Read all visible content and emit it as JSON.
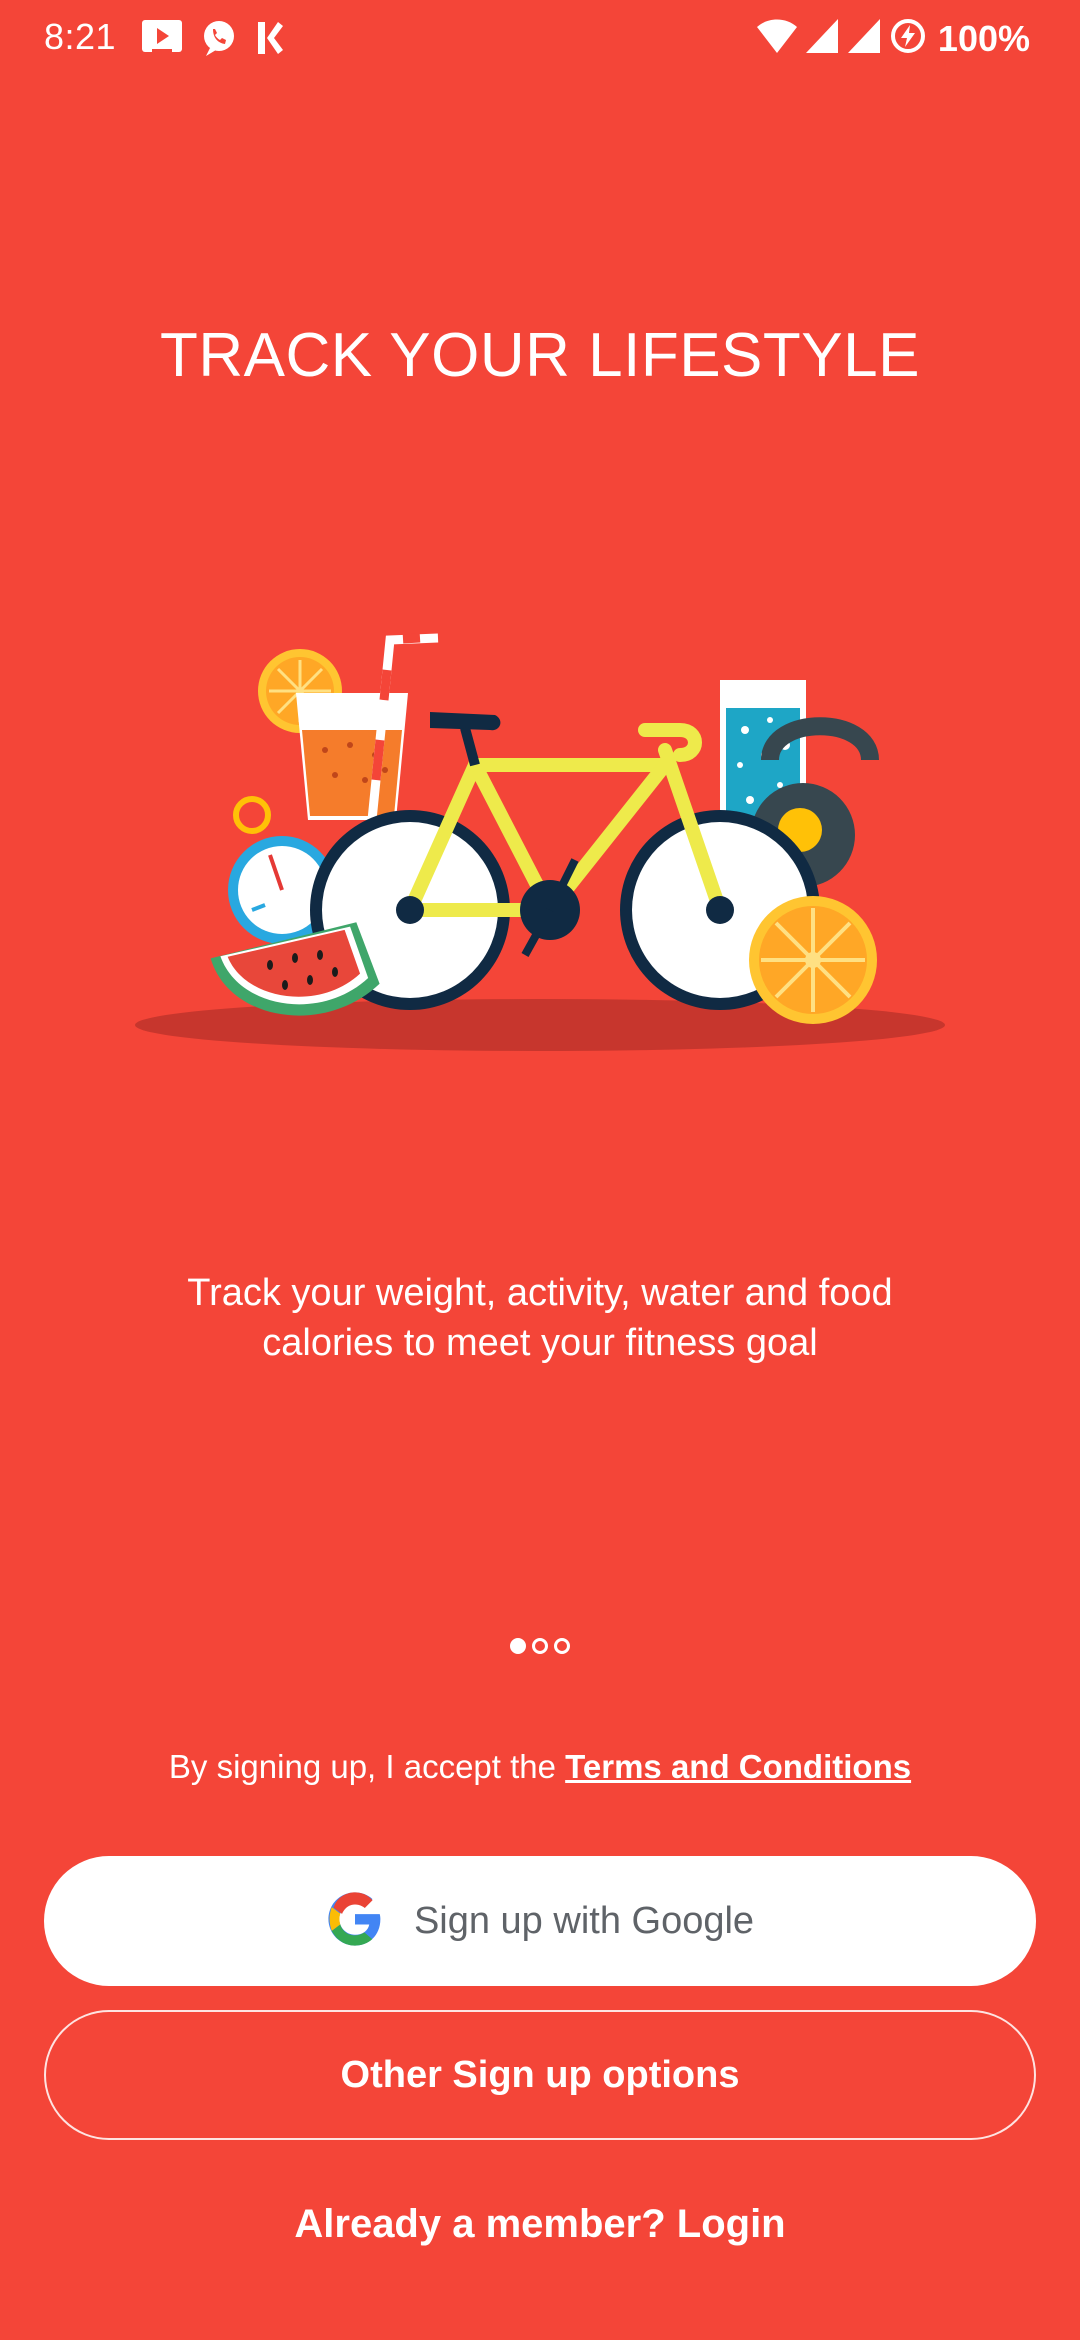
{
  "status_bar": {
    "time": "8:21",
    "left_icons": [
      "tv-play-icon",
      "phone-icon",
      "k-app-icon"
    ],
    "right_icons": [
      "wifi-icon",
      "signal-icon",
      "signal-icon",
      "battery-saver-icon"
    ],
    "battery": "100%"
  },
  "onboarding": {
    "title": "TRACK YOUR LIFESTYLE",
    "description": "Track your weight, activity, water and food calories to meet your fitness goal",
    "page_count": 3,
    "current_page": 1
  },
  "auth": {
    "terms_prefix": "By signing up, I accept the ",
    "terms_link": "Terms and Conditions",
    "google_button": "Sign up with Google",
    "other_button": "Other Sign up options",
    "member_prefix": "Already a member? ",
    "login_link": "Login"
  },
  "colors": {
    "background": "#F44538",
    "button_white": "#FFFFFF",
    "google_text": "#5F6368"
  }
}
